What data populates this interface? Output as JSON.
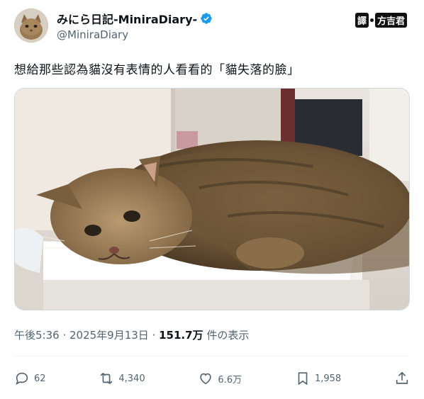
{
  "user": {
    "name": "みにら日記-MiniraDiary-",
    "handle": "@MiniraDiary",
    "verified_icon": "verified-badge-icon",
    "avatar_icon": "cat-avatar"
  },
  "watermark": {
    "left": "譯",
    "right": "方吉君"
  },
  "tweet": {
    "text": "想給那些認為貓沒有表情的人看看的「貓失落的臉」"
  },
  "meta": {
    "time": "午後5:36 · 2025年9月13日 · ",
    "views": "151.7万",
    "views_suffix": " 件の表示"
  },
  "actions": [
    {
      "icon": "reply-icon",
      "count": "62"
    },
    {
      "icon": "retweet-icon",
      "count": "4,340"
    },
    {
      "icon": "like-icon",
      "count": "6.6万"
    },
    {
      "icon": "bookmark-icon",
      "count": "1,958"
    },
    {
      "icon": "share-icon",
      "count": ""
    }
  ],
  "colors": {
    "text": "#0f1419",
    "secondary": "#536471",
    "verified": "#1d9bf0"
  }
}
